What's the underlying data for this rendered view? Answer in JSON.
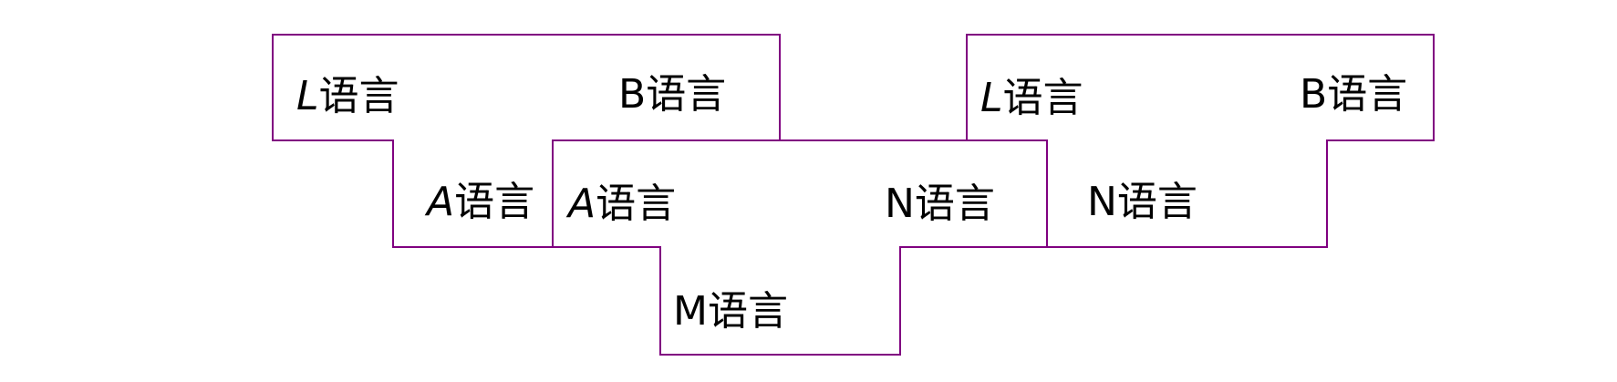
{
  "colors": {
    "outline": "#800080",
    "text": "#000000",
    "background": "#ffffff"
  },
  "diagrams": {
    "left_t": {
      "source_letter": "L",
      "target_letter": "B",
      "impl_letter": "A",
      "word": "语言"
    },
    "middle_t": {
      "source_letter": "A",
      "target_letter": "N",
      "impl_letter": "M",
      "word": "语言"
    },
    "right_t": {
      "source_letter": "L",
      "target_letter": "B",
      "impl_letter": "N",
      "word": "语言"
    }
  }
}
